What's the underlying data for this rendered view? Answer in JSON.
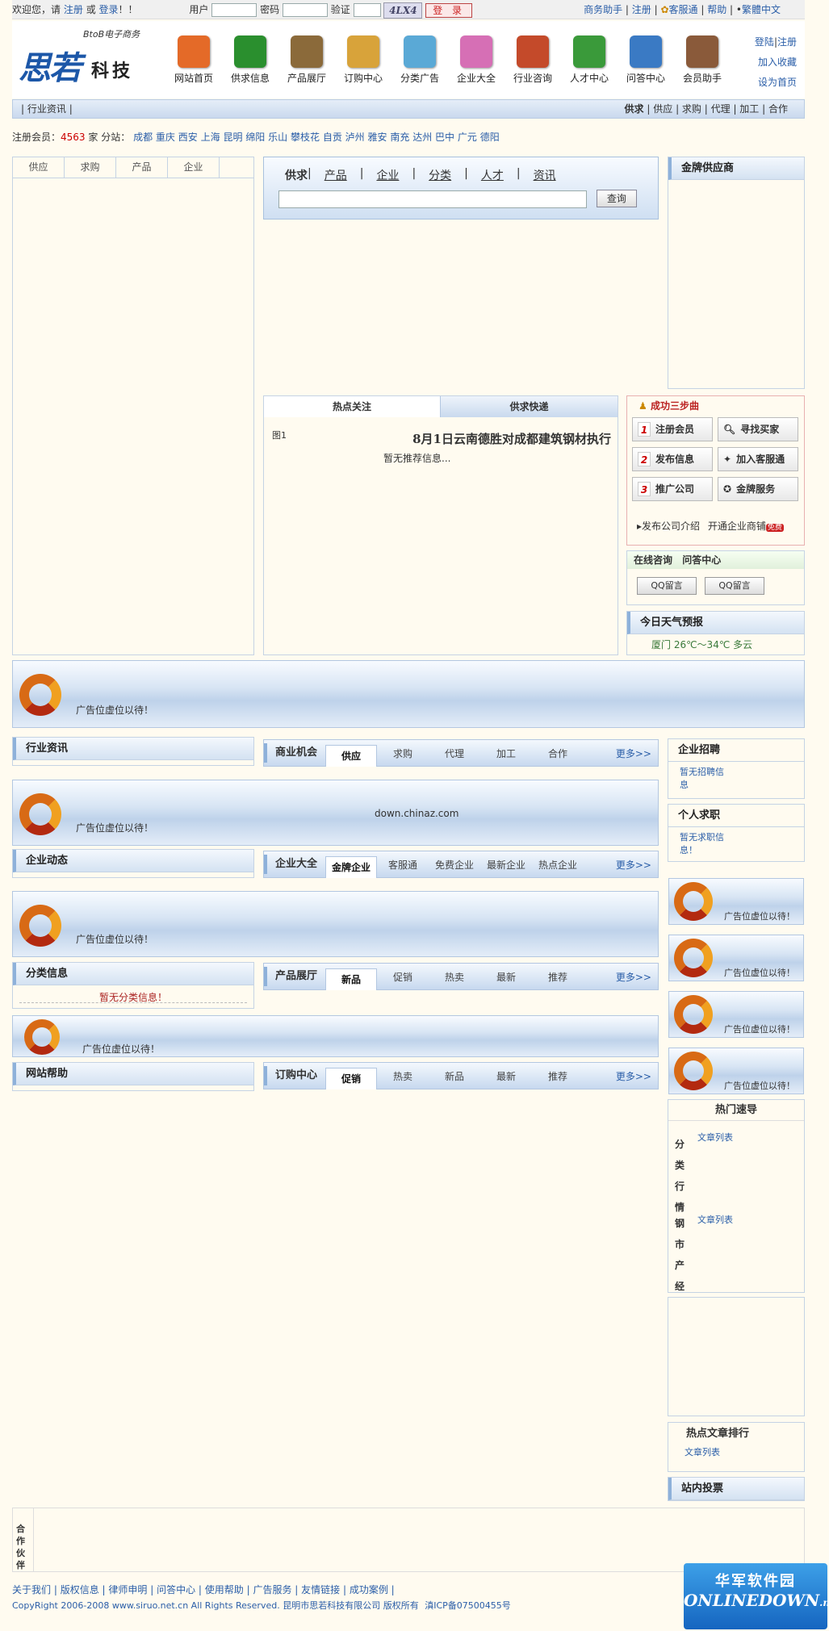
{
  "topbar": {
    "welcome": "欢迎您，请",
    "register": "注册",
    "or": "或",
    "login": "登录",
    "bang": "！！",
    "user_label": "用户",
    "pass_label": "密码",
    "verify_label": "验证",
    "captcha": "4LX4",
    "login_btn": "登 录",
    "links": [
      "商务助手",
      "注册",
      "客服通",
      "帮助",
      "繁體中文"
    ]
  },
  "header": {
    "logo_sub": "BtoB电子商务",
    "logo_main": "思若",
    "logo_kj": "科技",
    "nav": [
      "网站首页",
      "供求信息",
      "产品展厅",
      "订购中心",
      "分类广告",
      "企业大全",
      "行业咨询",
      "人才中心",
      "问答中心",
      "会员助手"
    ],
    "nav_colors": [
      "#e46a28",
      "#2a8f2e",
      "#8b6a3a",
      "#d8a33a",
      "#5aa9d6",
      "#d66fb5",
      "#c44a2a",
      "#3a9a3a",
      "#3a7ac4",
      "#8a5a3a"
    ],
    "right_links": [
      "登陆",
      "注册",
      "加入收藏",
      "设为首页"
    ]
  },
  "subnav": {
    "left": "行业资讯",
    "right": [
      "供求",
      "供应",
      "求购",
      "代理",
      "加工",
      "合作"
    ]
  },
  "citybar": {
    "label": "注册会员：",
    "count": "4563",
    "unit": "家",
    "branches": "分站：",
    "cities": [
      "成都",
      "重庆",
      "西安",
      "上海",
      "昆明",
      "绵阳",
      "乐山",
      "攀枝花",
      "自贡",
      "泸州",
      "雅安",
      "南充",
      "达州",
      "巴中",
      "广元",
      "德阳"
    ]
  },
  "lefttabs": [
    "供应",
    "求购",
    "产品",
    "企业"
  ],
  "search": {
    "tabs": [
      "供求",
      "产品",
      "企业",
      "分类",
      "人才",
      "资讯"
    ],
    "button": "查询"
  },
  "gold": {
    "title": "金牌供应商"
  },
  "hot": {
    "tab1": "热点关注",
    "tab2": "供求快递",
    "img": "图1",
    "headline": "8月1日云南德胜对成都建筑钢材执行",
    "none": "暂无推荐信息..."
  },
  "steps": {
    "title": "成功三步曲",
    "b1": "注册会员",
    "b2": "寻找买家",
    "b3": "发布信息",
    "b4": "加入客服通",
    "b5": "推广公司",
    "b6": "金牌服务",
    "n1": "1",
    "n2": "2",
    "n3": "3",
    "promo": "发布公司介绍",
    "open": "开通企业商铺",
    "free": "免费"
  },
  "consult": {
    "tab1": "在线咨询",
    "tab2": "问答中心",
    "qq": "QQ留言"
  },
  "weather": {
    "title": "今日天气预报",
    "text": "厦门 26℃～34℃ 多云"
  },
  "ad_text": "广告位虚位以待！",
  "ad_site": "down.chinaz.com",
  "sections": {
    "industry": "行业资讯",
    "biz": "商业机会",
    "biz_tabs": [
      "供应",
      "求购",
      "代理",
      "加工",
      "合作"
    ],
    "more": "更多>>",
    "dyn": "企业动态",
    "ent": "企业大全",
    "ent_tabs": [
      "金牌企业",
      "客服通",
      "免费企业",
      "最新企业",
      "热点企业"
    ],
    "cls": "分类信息",
    "cls_none": "暂无分类信息！",
    "prod": "产品展厅",
    "prod_tabs": [
      "新品",
      "促销",
      "热卖",
      "最新",
      "推荐"
    ],
    "help": "网站帮助",
    "order": "订购中心",
    "order_tabs": [
      "促销",
      "热卖",
      "新品",
      "最新",
      "推荐"
    ]
  },
  "right": {
    "recruit": "企业招聘",
    "recruit_none": "暂无招聘信息",
    "job": "个人求职",
    "job_none": "暂无求职信息！",
    "hot": "热门速导",
    "cat1": "分类行情",
    "cat2": "钢市产经",
    "list": "文章列表",
    "rank": "热点文章排行",
    "vote": "站内投票"
  },
  "partner": "合作伙伴",
  "footer": {
    "links": [
      "关于我们",
      "版权信息",
      "律师申明",
      "问答中心",
      "使用帮助",
      "广告服务",
      "友情链接",
      "成功案例"
    ],
    "copy": "CopyRight 2006-2008 www.siruo.net.cn All Rights Reserved. 昆明市思若科技有限公司 版权所有",
    "icp": "滇ICP备07500455号"
  },
  "watermark": {
    "cn": "华军软件园",
    "en": "ONLINEDOWN",
    "suffix": ".net"
  }
}
